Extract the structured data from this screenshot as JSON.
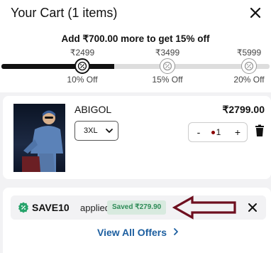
{
  "cart": {
    "title": "Your Cart (1 items)"
  },
  "offer": {
    "message": "Add ₹700.00 more to get 15% off",
    "progress_percent": 42,
    "tiers": [
      {
        "price": "₹2499",
        "label": "10% Off",
        "reached": true
      },
      {
        "price": "₹3499",
        "label": "15% Off",
        "reached": false
      },
      {
        "price": "₹5999",
        "label": "20% Off",
        "reached": false
      }
    ]
  },
  "item": {
    "name": "ABIGOL",
    "size": "3XL",
    "price": "₹2799.00",
    "quantity": "1",
    "minus": "-",
    "plus": "+"
  },
  "coupon": {
    "code": "SAVE10",
    "status": "applied",
    "saved": "Saved ₹279.90",
    "view_all": "View All Offers"
  },
  "colors": {
    "accent_link": "#1d5fa0",
    "saved_green": "#2e8b57",
    "annotation_arrow": "#6e0f1f"
  },
  "icons": {
    "close": "close-icon",
    "tier": "discount-badge-icon",
    "size_dropdown": "chevron-down-icon",
    "delete": "trash-icon",
    "coupon": "verified-badge-icon",
    "view_all": "chevron-right-icon"
  }
}
